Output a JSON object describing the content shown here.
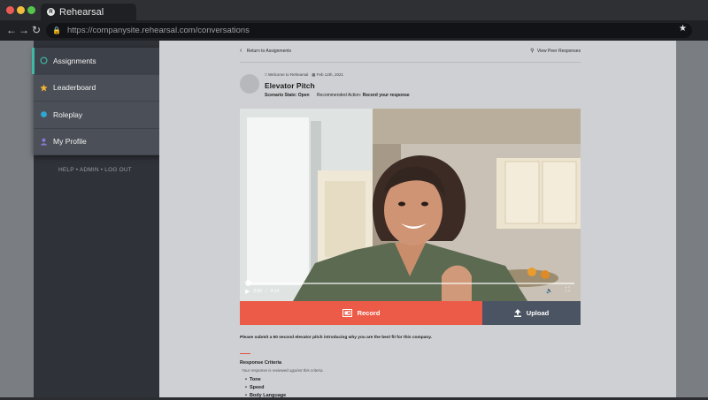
{
  "browser": {
    "tab_title": "Rehearsal",
    "tab_logo_letter": "R",
    "url": "https://companysite.rehearsal.com/conversations"
  },
  "colors": {
    "accent_teal": "#3fb8a6",
    "record_red": "#ec5b47",
    "upload_slate": "#4b5462",
    "leaderboard_star": "#f2b433",
    "roleplay_dot": "#2fa6d6",
    "profile_purple": "#8a7ad6"
  },
  "sidebar": {
    "items": [
      {
        "label": "Assignments",
        "icon": "circle-outline-icon"
      },
      {
        "label": "Leaderboard",
        "icon": "star-icon"
      },
      {
        "label": "Roleplay",
        "icon": "dot-icon"
      },
      {
        "label": "My Profile",
        "icon": "person-icon"
      }
    ],
    "footer_links": [
      "HELP",
      "ADMIN",
      "LOG OUT"
    ]
  },
  "main": {
    "back_link": "Return to Assignments",
    "peer_link": "View Peer Responses",
    "meta_author": "Welcome to Rehearsal",
    "meta_date": "Feb 12th, 2021",
    "title": "Elevator Pitch",
    "scenario_state_label": "Scenario State:",
    "scenario_state_value": "Open",
    "recommended_action_label": "Recommended Action:",
    "recommended_action_value": "Record your response",
    "video": {
      "time_current": "0:00",
      "time_total": "0:14"
    },
    "record_label": "Record",
    "upload_label": "Upload",
    "instructions": "Please submit a 60 second elevator pitch introducing why you are the best fit for this company.",
    "criteria_title": "Response Criteria",
    "criteria_subtitle": "Your response is reviewed against this criteria.",
    "criteria_items": [
      "Tone",
      "Speed",
      "Body Language"
    ]
  }
}
